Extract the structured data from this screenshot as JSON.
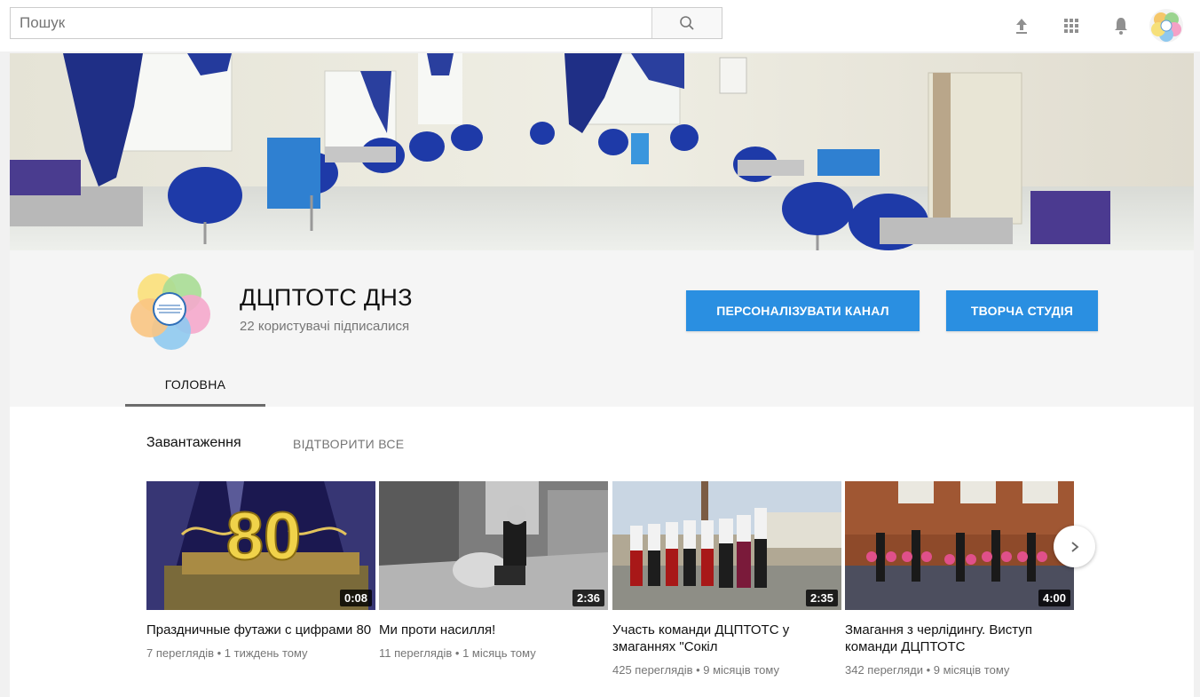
{
  "search": {
    "placeholder": "Пошук",
    "value": ""
  },
  "topbar": {
    "icons": [
      "upload-icon",
      "apps-grid-icon",
      "notifications-bell-icon",
      "account-avatar"
    ]
  },
  "channel": {
    "name": "ДЦПТОТС ДНЗ",
    "subscribers": "22 користувачі підписалися",
    "customize_label": "ПЕРСОНАЛІЗУВАТИ КАНАЛ",
    "studio_label": "ТВОРЧА СТУДІЯ",
    "tabs": [
      {
        "label": "ГОЛОВНА",
        "active": true
      }
    ]
  },
  "shelf": {
    "title": "Завантаження",
    "play_all": "ВІДТВОРИТИ ВСЕ",
    "videos": [
      {
        "title": "Праздничные футажи с цифрами 80",
        "duration": "0:08",
        "meta": "7 переглядів • 1 тиждень тому",
        "thumb_text": "80"
      },
      {
        "title": "Ми проти насилля!",
        "duration": "2:36",
        "meta": "11 переглядів • 1 місяць тому"
      },
      {
        "title": "Участь команди ДЦПТОТС у змаганнях \"Сокіл",
        "duration": "2:35",
        "meta": "425 переглядів • 9 місяців тому"
      },
      {
        "title": "Змагання з черлідингу. Виступ команди ДЦПТОТС",
        "duration": "4:00",
        "meta": "342 перегляди • 9 місяців тому"
      }
    ]
  },
  "colors": {
    "accent_blue": "#2a8fe1",
    "banner_blue": "#1e3aa8",
    "page_bg": "#f1f1f1"
  }
}
